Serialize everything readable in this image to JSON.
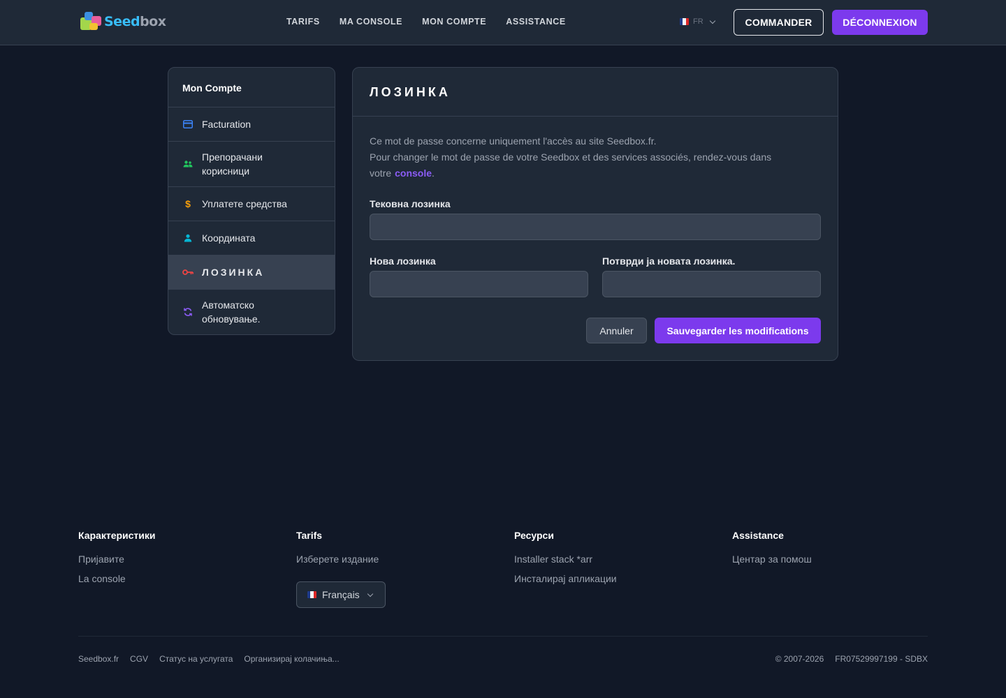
{
  "header": {
    "logo_part1": "Seed",
    "logo_part2": "box",
    "nav": [
      "TARIFS",
      "MA CONSOLE",
      "MON COMPTE",
      "ASSISTANCE"
    ],
    "lang": "FR",
    "commander": "COMMANDER",
    "logout": "DÉCONNEXION"
  },
  "sidebar": {
    "title": "Mon Compte",
    "items": [
      {
        "label": "Facturation",
        "icon": "credit-card-icon",
        "color": "#3b82f6"
      },
      {
        "label": "Препорачани корисници",
        "icon": "users-icon",
        "color": "#22c55e"
      },
      {
        "label": "Уплатете средства",
        "icon": "dollar-icon",
        "color": "#f59e0b"
      },
      {
        "label": "Координата",
        "icon": "user-icon",
        "color": "#06b6d4"
      },
      {
        "label": "ЛОЗИНКА",
        "icon": "key-icon",
        "color": "#ef4444"
      },
      {
        "label": "Автоматско обновување.",
        "icon": "refresh-icon",
        "color": "#8b5cf6"
      }
    ]
  },
  "main": {
    "title": "ЛОЗИНКА",
    "desc_line1": "Ce mot de passe concerne uniquement l'accès au site Seedbox.fr.",
    "desc_line2": "Pour changer le mot de passe de votre Seedbox et des services associés, rendez-vous dans votre",
    "desc_link": "console",
    "current_label": "Тековна лозинка",
    "new_label": "Нова лозинка",
    "confirm_label": "Потврди ја новата лозинка.",
    "cancel": "Annuler",
    "save": "Sauvegarder les modifications"
  },
  "footer": {
    "col1": {
      "title": "Карактеристики",
      "links": [
        "Пријавите",
        "La console"
      ]
    },
    "col2": {
      "title": "Tarifs",
      "links": [
        "Изберете издание"
      ],
      "lang_select": "Français"
    },
    "col3": {
      "title": "Ресурси",
      "links": [
        "Installer stack *arr",
        "Инсталирај апликации"
      ]
    },
    "col4": {
      "title": "Assistance",
      "links": [
        "Центар за помош"
      ]
    },
    "bottom_links": [
      "Seedbox.fr",
      "CGV",
      "Статус на услугата",
      "Организирај колачиња..."
    ],
    "copyright": "© 2007-2026",
    "company_id": "FR07529997199 - SDBX"
  },
  "colors": {
    "accent": "#7c3aed",
    "background": "#111827",
    "panel": "#1f2937"
  }
}
